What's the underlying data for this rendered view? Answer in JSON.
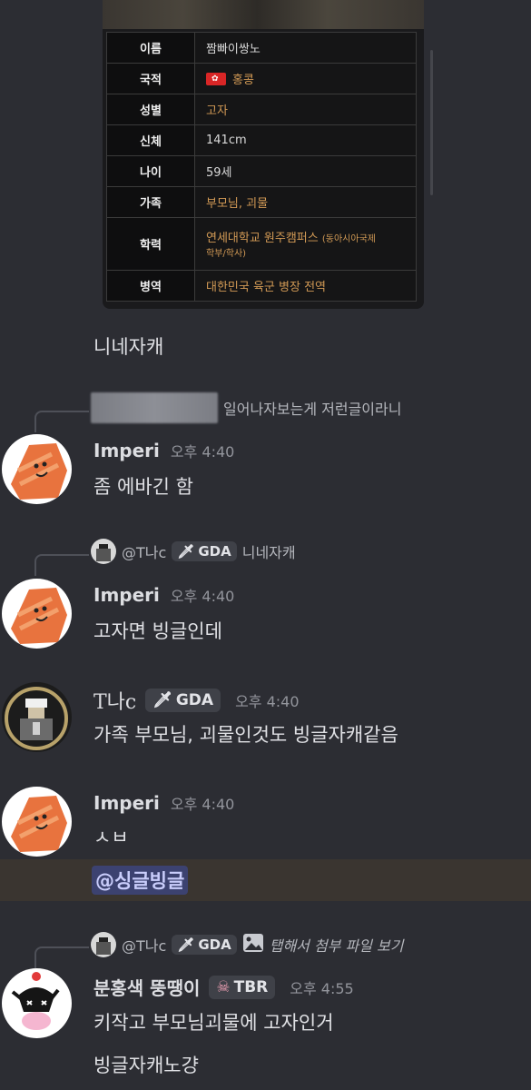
{
  "profile_table": {
    "rows": [
      {
        "key": "이름",
        "value": "짬빠이쌍노",
        "style": "white"
      },
      {
        "key": "국적",
        "value": "홍콩",
        "flag": true
      },
      {
        "key": "성별",
        "value": "고자"
      },
      {
        "key": "신체",
        "value": "141cm",
        "style": "white"
      },
      {
        "key": "나이",
        "value": "59세",
        "style": "white"
      },
      {
        "key": "가족",
        "value": "부모님, 괴물"
      },
      {
        "key": "학력",
        "value": "연세대학교 원주캠퍼스",
        "value_note": "(동아시아국제",
        "value_line2": "학부/학사)"
      },
      {
        "key": "병역",
        "value": "대한민국 육군 병장 전역"
      }
    ]
  },
  "messages": [
    {
      "text": "니네자캐"
    },
    {
      "reply_preview": "일어나자보는게 저런글이라니",
      "username": "Imperi",
      "time": "오후 4:40",
      "text": "좀 에바긴 함"
    },
    {
      "reply_user": "@T나c",
      "reply_tag": "GDA",
      "reply_preview": "니네자캐",
      "username": "Imperi",
      "time": "오후 4:40",
      "text": "고자면 빙글인데"
    },
    {
      "username": "T나c",
      "tag": "GDA",
      "time": "오후 4:40",
      "text": "가족 부모님, 괴물인것도 빙글자캐같음"
    },
    {
      "username": "Imperi",
      "time": "오후 4:40",
      "text": "ㅅㅂ",
      "mention": "@싱글빙글"
    },
    {
      "reply_user": "@T나c",
      "reply_tag": "GDA",
      "reply_preview": "탭해서 첨부 파일 보기",
      "username": "분홍색 뚱땡이",
      "tag": "TBR",
      "time": "오후 4:55",
      "text": "키작고 부모님괴물에 고자인거",
      "text2": "빙글자캐노걍"
    }
  ],
  "icons": {
    "flag": "hong-kong-flag-icon",
    "sword": "sword-icon",
    "skull": "skull-icon",
    "image": "image-attachment-icon"
  },
  "colors": {
    "background": "#2c2d33",
    "table_value_gold": "#d29a55",
    "mention_highlight": "#3a3530",
    "mention_pill": "#3c4270"
  }
}
